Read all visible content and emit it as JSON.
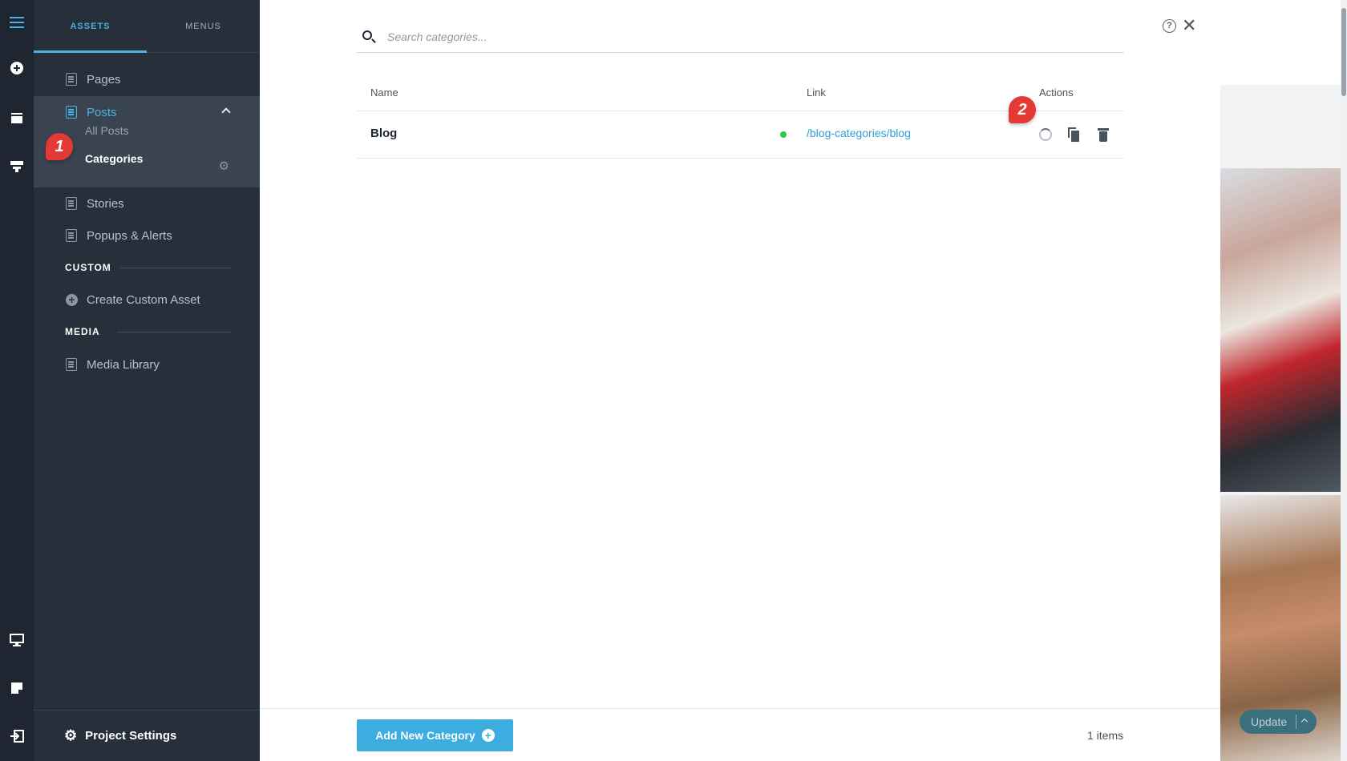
{
  "rail": {
    "icons": [
      "hamburger-menu-icon",
      "add-circle-icon",
      "layers-icon",
      "components-icon",
      "desktop-icon",
      "note-icon",
      "exit-icon"
    ],
    "accent": "#4ab3e2"
  },
  "panel": {
    "tabs": [
      {
        "label": "ASSETS",
        "active": true
      },
      {
        "label": "MENUS",
        "active": false
      }
    ],
    "items": {
      "pages": "Pages",
      "posts": "Posts",
      "all_posts": "All Posts",
      "categories": "Categories",
      "stories": "Stories",
      "popups": "Popups & Alerts"
    },
    "sections": {
      "custom": "CUSTOM",
      "create_custom_asset": "Create Custom Asset",
      "media": "MEDIA",
      "media_library": "Media Library"
    },
    "project_settings": "Project Settings"
  },
  "main": {
    "search": {
      "placeholder": "Search categories...",
      "value": ""
    },
    "table": {
      "headers": [
        "Name",
        "Link",
        "Actions"
      ],
      "rows": [
        {
          "name": "Blog",
          "status": "published",
          "status_color": "#2ecc40",
          "link": "/blog-categories/blog"
        }
      ]
    },
    "add_button": "Add New Category",
    "items_count": "1 items"
  },
  "annotations": [
    {
      "number": "1",
      "color": "#e53935"
    },
    {
      "number": "2",
      "color": "#e53935"
    }
  ],
  "preview": {
    "update_button": "Update"
  }
}
